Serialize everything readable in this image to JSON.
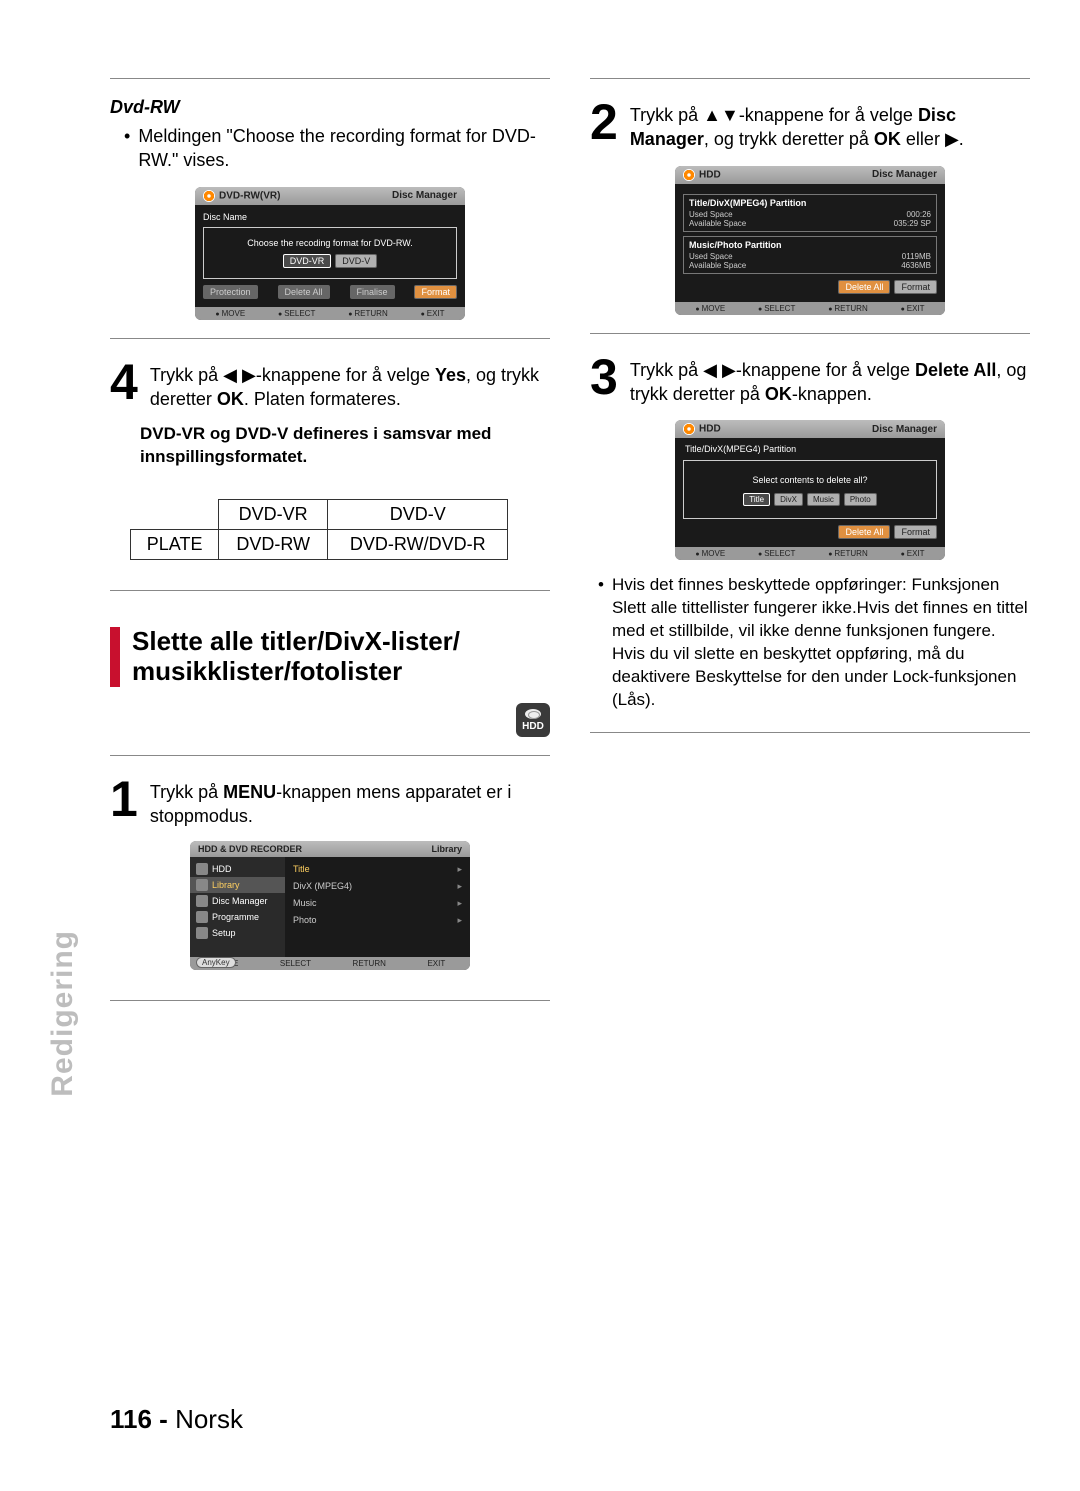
{
  "left": {
    "dvdrw_heading": "Dvd-RW",
    "dvdrw_msg": "Meldingen \"Choose the recording format for DVD- RW.\" vises.",
    "panel1": {
      "hdr_left": "DVD-RW(VR)",
      "hdr_right": "Disc Manager",
      "disc_name_label": "Disc Name",
      "prompt": "Choose the recoding format for DVD-RW.",
      "btns": [
        "DVD-VR",
        "DVD-V"
      ],
      "bots": [
        "Protection",
        "Delete All",
        "Finalise",
        "Format"
      ],
      "footer": [
        "MOVE",
        "SELECT",
        "RETURN",
        "EXIT"
      ]
    },
    "step4": {
      "num": "4",
      "text_pre": "Trykk på ",
      "arrows": "◀ ▶",
      "text_mid": "-knappene for å velge ",
      "yes": "Yes",
      "text_mid2": ", og trykk deretter ",
      "ok": "OK",
      "text_end": ". Platen formateres.",
      "note": "DVD-VR og DVD-V defineres i samsvar med innspillingsformatet."
    },
    "table": {
      "h1": "DVD-VR",
      "h2": "DVD-V",
      "r1c0": "PLATE",
      "r1c1": "DVD-RW",
      "r1c2": "DVD-RW/DVD-R"
    },
    "big_title_l1": "Slette alle titler/DivX-lister/",
    "big_title_l2": "musikklister/fotolister",
    "hdd_label": "HDD",
    "step1": {
      "num": "1",
      "text_pre": "Trykk på ",
      "menu": "MENU",
      "text_end": "-knappen mens apparatet er i stoppmodus."
    },
    "libpanel": {
      "top_l": "HDD & DVD RECORDER",
      "top_r": "Library",
      "left_items": [
        "HDD",
        "Library",
        "Disc Manager",
        "Programme",
        "Setup"
      ],
      "right_items": [
        "Title",
        "DivX (MPEG4)",
        "Music",
        "Photo"
      ],
      "footer": [
        "MOVE",
        "SELECT",
        "RETURN",
        "EXIT"
      ],
      "anykey": "AnyKey"
    }
  },
  "right": {
    "step2": {
      "num": "2",
      "text_pre": "Trykk på ",
      "arrows": "▲▼",
      "text_mid": "-knappene for å velge ",
      "dm": "Disc Manager",
      "text_mid2": ", og trykk deretter på ",
      "ok": "OK",
      "text_end": " eller ▶."
    },
    "panel2": {
      "hdr_left": "HDD",
      "hdr_right": "Disc Manager",
      "g1_title": "Title/DivX(MPEG4) Partition",
      "g1_rows": [
        [
          "Used Space",
          "000:26"
        ],
        [
          "Available Space",
          "035:29 SP"
        ]
      ],
      "g2_title": "Music/Photo Partition",
      "g2_rows": [
        [
          "Used Space",
          "0119MB"
        ],
        [
          "Available Space",
          "4636MB"
        ]
      ],
      "bots": [
        "Delete All",
        "Format"
      ],
      "footer": [
        "MOVE",
        "SELECT",
        "RETURN",
        "EXIT"
      ]
    },
    "step3": {
      "num": "3",
      "text_pre": "Trykk på ",
      "arrows": "◀ ▶",
      "text_mid": "-knappene for å velge ",
      "da": "Delete All",
      "text_mid2": ", og trykk deretter på ",
      "ok": "OK",
      "text_end": "-knappen."
    },
    "panel3": {
      "hdr_left": "HDD",
      "hdr_right": "Disc Manager",
      "g1_title": "Title/DivX(MPEG4) Partition",
      "prompt": "Select contents to delete all?",
      "sel_btns": [
        "Title",
        "DivX",
        "Music",
        "Photo"
      ],
      "bots": [
        "Delete All",
        "Format"
      ],
      "footer": [
        "MOVE",
        "SELECT",
        "RETURN",
        "EXIT"
      ]
    },
    "bullets": [
      "Hvis det finnes beskyttede oppføringer: Funksjonen Slett alle tittellister fungerer ikke.Hvis det finnes en tittel med et stillbilde, vil ikke denne funksjonen fungere. Hvis du vil slette en beskyttet oppføring, må du deaktivere  Beskyttelse for den under Lock-funksjonen (Lås)."
    ]
  },
  "side_tab": "Redigering",
  "footer_page": "116 -",
  "footer_lang": "Norsk"
}
